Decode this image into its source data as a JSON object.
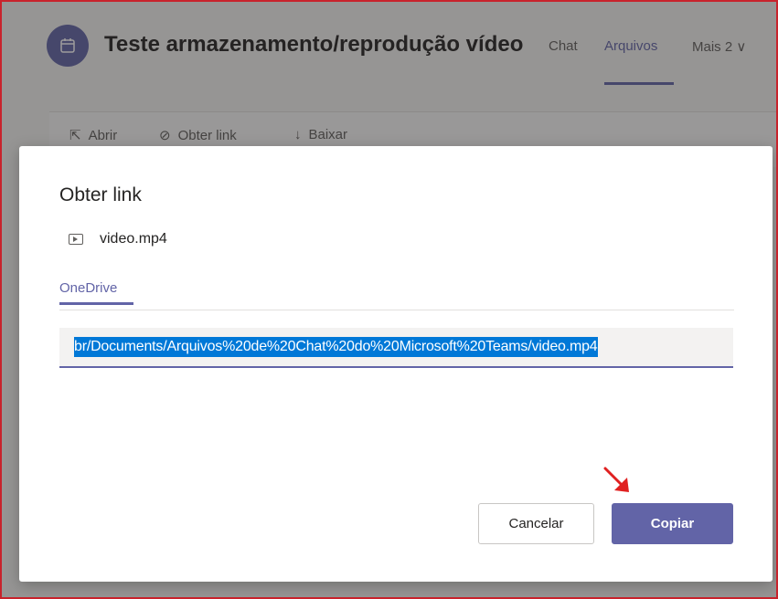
{
  "header": {
    "channel_title": "Teste armazenamento/reprodução vídeo",
    "tabs": [
      {
        "label": "Chat",
        "active": false
      },
      {
        "label": "Arquivos",
        "active": true
      },
      {
        "label": "Mais 2 ∨",
        "active": false
      }
    ]
  },
  "toolbar": {
    "open_label": "Abrir",
    "get_link_label": "Obter link",
    "download_label": "Baixar"
  },
  "dialog": {
    "title": "Obter link",
    "file_name": "video.mp4",
    "tab_label": "OneDrive",
    "link_value": "br/Documents/Arquivos%20de%20Chat%20do%20Microsoft%20Teams/video.mp4",
    "cancel_label": "Cancelar",
    "copy_label": "Copiar"
  },
  "colors": {
    "accent": "#6264a7",
    "selection": "#0078d7",
    "annotation_arrow": "#e02020"
  }
}
